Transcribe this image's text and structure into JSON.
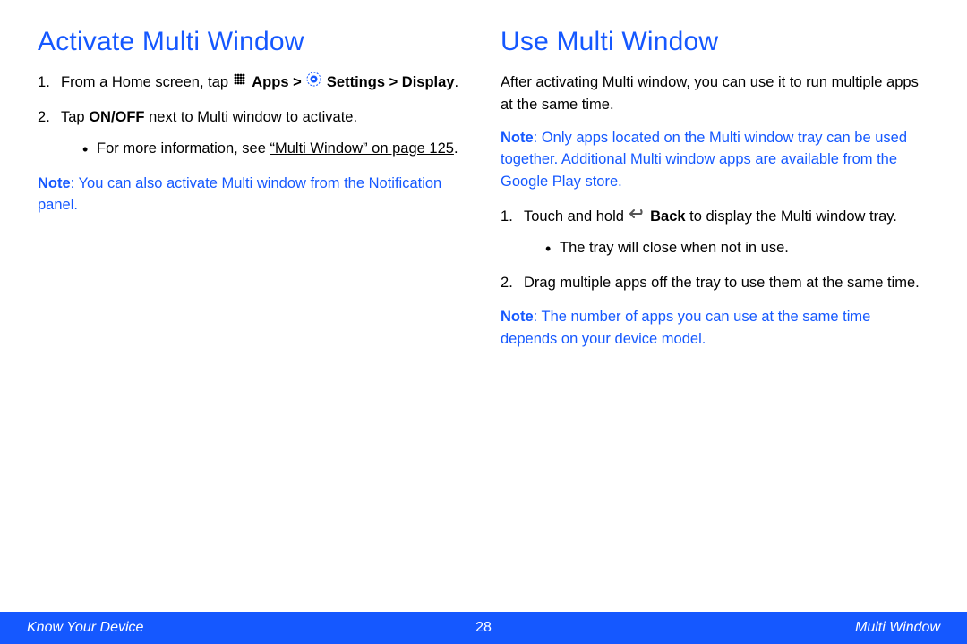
{
  "left": {
    "heading": "Activate Multi Window",
    "step1_a": "From a Home screen, tap ",
    "step1_apps": "Apps > ",
    "step1_settings": "Settings > Display",
    "step1_end": ".",
    "step2_a": "Tap ",
    "step2_b": "ON/OFF",
    "step2_c": " next to Multi window to activate.",
    "bullet_a": "For more information, see ",
    "bullet_link": "“Multi Window” on page 125",
    "bullet_end": ".",
    "note_label": "Note",
    "note_text": ": You can also activate Multi window from the Notification panel."
  },
  "right": {
    "heading": "Use Multi Window",
    "intro": "After activating Multi window, you can use it to run multiple apps at the same time.",
    "note1_label": "Note",
    "note1_text": ": Only apps located on the Multi window tray can be used together. Additional Multi window apps are available from the Google Play store.",
    "step1_a": "Touch and hold ",
    "step1_b": "Back",
    "step1_c": " to display the Multi window tray.",
    "bullet": "The tray will close when not in use.",
    "step2": "Drag multiple apps off the tray to use them at the same time.",
    "note2_label": "Note",
    "note2_text": ": The number of apps you can use at the same time depends on your device model."
  },
  "footer": {
    "left": "Know Your Device",
    "center": "28",
    "right": "Multi Window"
  }
}
